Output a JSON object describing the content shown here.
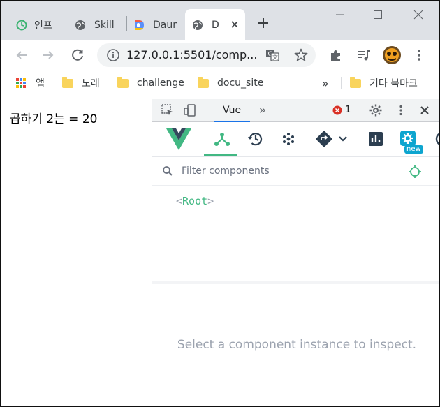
{
  "browser": {
    "tabs": [
      {
        "label": "인프",
        "icon": "refresh-green-icon"
      },
      {
        "label": "Skill",
        "icon": "globe-icon"
      },
      {
        "label": "Daur",
        "icon": "d-logo-icon"
      },
      {
        "label": "D",
        "icon": "globe-icon",
        "active": true
      }
    ],
    "url": "127.0.0.1:5501/comp..."
  },
  "bookmarks": {
    "items": [
      {
        "label": "앱",
        "type": "apps"
      },
      {
        "label": "노래",
        "type": "folder"
      },
      {
        "label": "challenge",
        "type": "folder"
      },
      {
        "label": "docu_site",
        "type": "folder"
      }
    ],
    "overflow": "»",
    "other": "기타 북마크"
  },
  "page": {
    "text": "곱하기 2는 = 20"
  },
  "devtools": {
    "active_tab": "Vue",
    "more": "»",
    "error_count": "1",
    "filter_placeholder": "Filter components",
    "root_name": "Root",
    "root_open": "<",
    "root_close": ">",
    "new_badge": "new",
    "empty_message": "Select a component instance to inspect."
  },
  "colors": {
    "vue_green": "#42b883",
    "vue_dark": "#35495e",
    "tab_strip": "#dee1e6",
    "devtools_bar": "#f1f3f4",
    "accent_blue": "#1a73e8",
    "badge_blue": "#0da5cf"
  }
}
